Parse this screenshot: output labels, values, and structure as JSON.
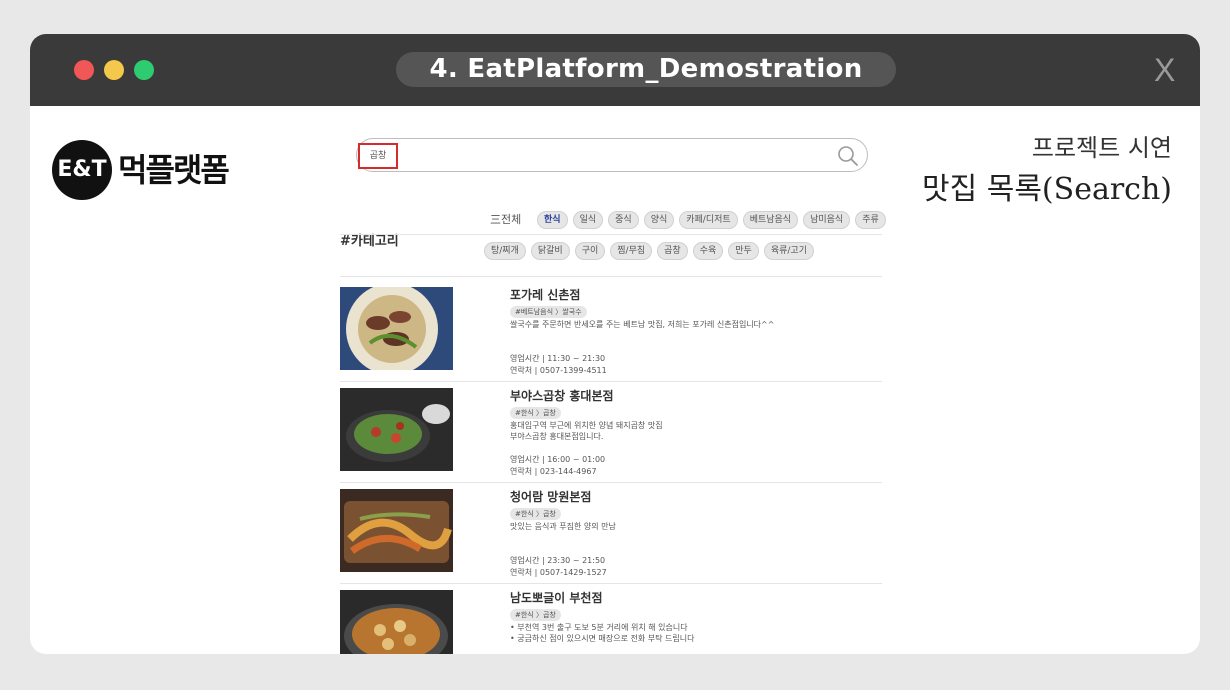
{
  "window": {
    "title": "4. EatPlatform_Demostration",
    "close_label": "X"
  },
  "brand": {
    "logo_text": "E&T",
    "name": "먹플랫폼"
  },
  "caption": {
    "line1": "프로젝트 시연",
    "line2": "맛집 목록(Search)"
  },
  "search": {
    "value": "곱창"
  },
  "category": {
    "label": "#카테고리",
    "all_label": "三전체",
    "row1": [
      "한식",
      "일식",
      "중식",
      "양식",
      "카페/디저트",
      "베트남음식",
      "남미음식",
      "주류"
    ],
    "row2": [
      "탕/찌개",
      "닭갈비",
      "구이",
      "찜/무침",
      "곱창",
      "수육",
      "만두",
      "육류/고기"
    ],
    "active": "한식"
  },
  "restaurants": [
    {
      "name": "포가레 신촌점",
      "tag": "#베트남음식 〉쌀국수",
      "desc": [
        "쌀국수를 주문하면 반세오를 주는 베트남 맛집, 저희는 포가레 신촌점입니다^^"
      ],
      "hours": "영업시간 | 11:30 ~ 21:30",
      "phone": "연락처 | 0507-1399-4511"
    },
    {
      "name": "부야스곱창 홍대본점",
      "tag": "#한식 〉곱창",
      "desc": [
        "홍대입구역 부근에 위치한 양념 돼지곱창 맛집",
        "부야스곱창 홍대본점입니다."
      ],
      "hours": "영업시간 | 16:00 ~ 01:00",
      "phone": "연락처 | 023-144-4967"
    },
    {
      "name": "청어람 망원본점",
      "tag": "#한식 〉곱창",
      "desc": [
        "맛있는 음식과 푸짐한 양의 만남"
      ],
      "hours": "영업시간 | 23:30 ~ 21:50",
      "phone": "연락처 | 0507-1429-1527"
    },
    {
      "name": "남도뽀글이 부천점",
      "tag": "#한식 〉곱창",
      "desc": [
        "• 부천역 3번 출구 도보 5분 거리에 위치 해 있습니다",
        "• 궁금하신 점이 있으시면 매장으로 전화 부탁 드립니다"
      ],
      "hours": "",
      "phone": ""
    }
  ],
  "colors": {
    "titlebar": "#3a3a3a",
    "dot_red": "#f25757",
    "dot_yellow": "#f4c84a",
    "dot_green": "#2ecc71",
    "highlight": "#d62b2b",
    "active_chip": "#2b3f9b"
  }
}
